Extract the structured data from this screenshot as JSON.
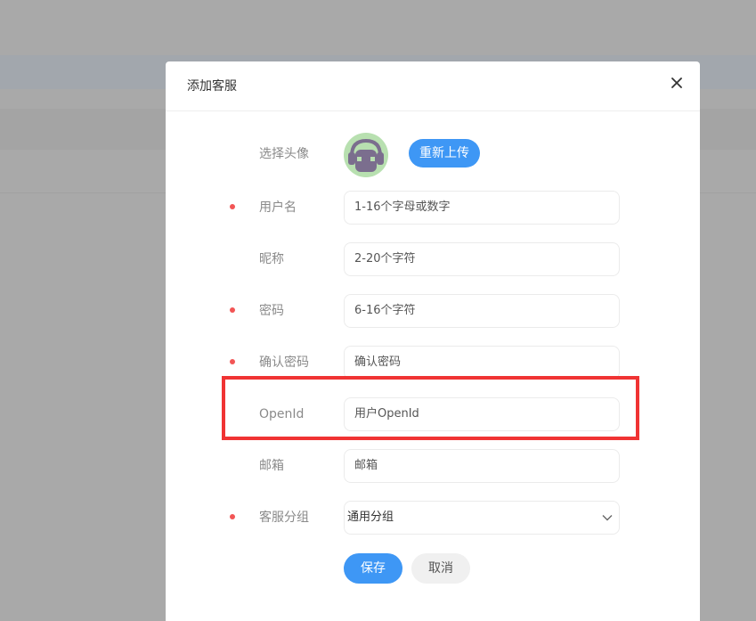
{
  "dialog": {
    "title": "添加客服"
  },
  "avatar": {
    "label": "选择头像",
    "upload_label": "重新上传"
  },
  "form": {
    "username": {
      "label": "用户名",
      "required": true,
      "placeholder": "1-16个字母或数字"
    },
    "nickname": {
      "label": "昵称",
      "required": false,
      "placeholder": "2-20个字符"
    },
    "password": {
      "label": "密码",
      "required": true,
      "placeholder": "6-16个字符"
    },
    "confirm_password": {
      "label": "确认密码",
      "required": true,
      "placeholder": "确认密码"
    },
    "openid": {
      "label": "OpenId",
      "required": false,
      "placeholder": "用户OpenId"
    },
    "email": {
      "label": "邮箱",
      "required": false,
      "placeholder": "邮箱"
    },
    "group": {
      "label": "客服分组",
      "required": true,
      "value": "通用分组"
    }
  },
  "actions": {
    "save_label": "保存",
    "cancel_label": "取消"
  },
  "colors": {
    "primary": "#3e97f5",
    "required": "#f25555",
    "highlight": "#f03333",
    "avatar_bg": "#b8e0b0",
    "avatar_figure": "#7b6e8e"
  },
  "icons": {
    "close": "close-icon",
    "select": "chevron-down-icon",
    "avatar": "avatar-icon"
  }
}
